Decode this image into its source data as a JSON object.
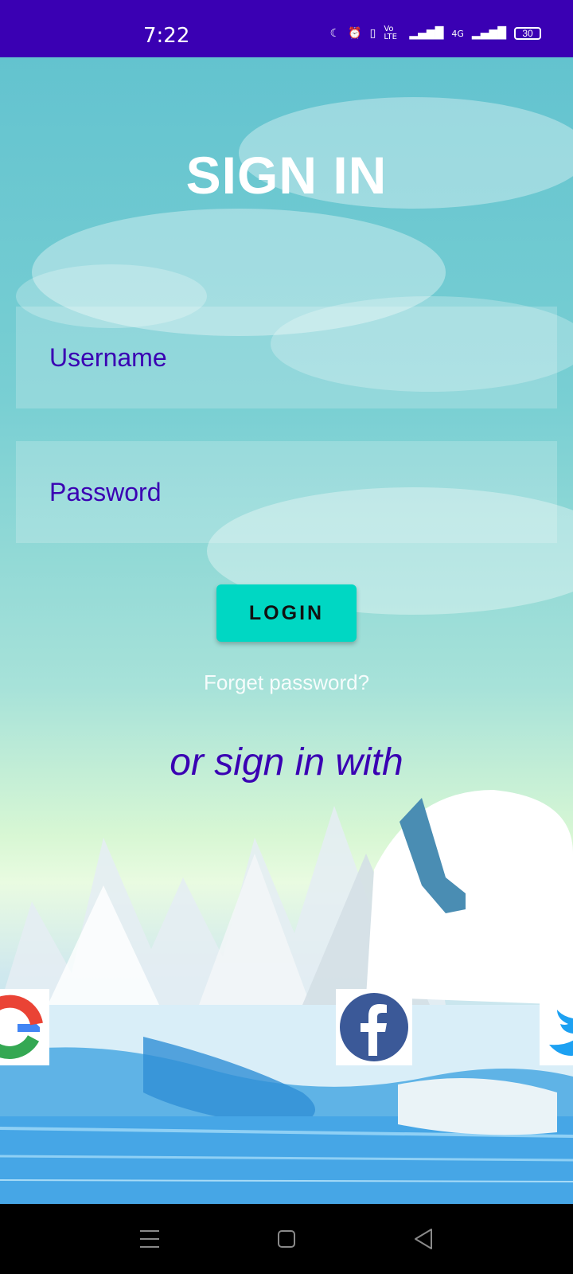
{
  "status_bar": {
    "time": "7:22",
    "icons": [
      "moon-icon",
      "alarm-icon",
      "vibrate-icon",
      "volte-icon",
      "signal-icon",
      "4g-icon",
      "signal-icon"
    ],
    "volte_label": "Vo LTE",
    "network_label": "4G",
    "battery": "30"
  },
  "page": {
    "title": "SIGN IN",
    "username_placeholder": "Username",
    "password_placeholder": "Password",
    "login_label": "LOGIN",
    "forgot_label": "Forget password?",
    "alt_signin_label": "or sign in with"
  },
  "social": [
    {
      "name": "google",
      "icon": "google-icon"
    },
    {
      "name": "facebook",
      "icon": "facebook-icon"
    },
    {
      "name": "twitter",
      "icon": "twitter-icon"
    }
  ],
  "colors": {
    "status_bar": "#3a00b3",
    "accent_text": "#3a00b3",
    "login_button": "#00d7c3",
    "facebook": "#3b5998",
    "twitter": "#1da1f2"
  }
}
